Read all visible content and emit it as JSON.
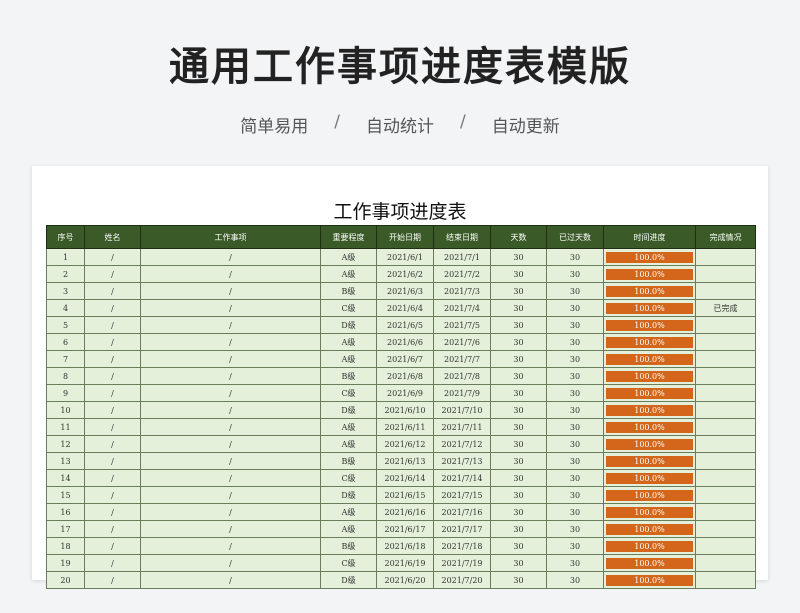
{
  "header": {
    "title": "通用工作事项进度表模版",
    "tags": [
      "简单易用",
      "自动统计",
      "自动更新"
    ],
    "separator": "/"
  },
  "sheet": {
    "title": "工作事项进度表",
    "columns": [
      "序号",
      "姓名",
      "工作事项",
      "重要程度",
      "开始日期",
      "结束日期",
      "天数",
      "已过天数",
      "时间进度",
      "完成情况"
    ],
    "progress_color": "#d3661a",
    "header_color": "#3a5a27",
    "row_color": "#e4f0d9",
    "rows": [
      {
        "no": "1",
        "name": "/",
        "task": "/",
        "level": "A级",
        "start": "2021/6/1",
        "end": "2021/7/1",
        "days": "30",
        "passed": "30",
        "progress": "100.0%",
        "progress_value": 1.0,
        "status": ""
      },
      {
        "no": "2",
        "name": "/",
        "task": "/",
        "level": "A级",
        "start": "2021/6/2",
        "end": "2021/7/2",
        "days": "30",
        "passed": "30",
        "progress": "100.0%",
        "progress_value": 1.0,
        "status": ""
      },
      {
        "no": "3",
        "name": "/",
        "task": "/",
        "level": "B级",
        "start": "2021/6/3",
        "end": "2021/7/3",
        "days": "30",
        "passed": "30",
        "progress": "100.0%",
        "progress_value": 1.0,
        "status": ""
      },
      {
        "no": "4",
        "name": "/",
        "task": "/",
        "level": "C级",
        "start": "2021/6/4",
        "end": "2021/7/4",
        "days": "30",
        "passed": "30",
        "progress": "100.0%",
        "progress_value": 1.0,
        "status": "已完成"
      },
      {
        "no": "5",
        "name": "/",
        "task": "/",
        "level": "D级",
        "start": "2021/6/5",
        "end": "2021/7/5",
        "days": "30",
        "passed": "30",
        "progress": "100.0%",
        "progress_value": 1.0,
        "status": ""
      },
      {
        "no": "6",
        "name": "/",
        "task": "/",
        "level": "A级",
        "start": "2021/6/6",
        "end": "2021/7/6",
        "days": "30",
        "passed": "30",
        "progress": "100.0%",
        "progress_value": 1.0,
        "status": ""
      },
      {
        "no": "7",
        "name": "/",
        "task": "/",
        "level": "A级",
        "start": "2021/6/7",
        "end": "2021/7/7",
        "days": "30",
        "passed": "30",
        "progress": "100.0%",
        "progress_value": 1.0,
        "status": ""
      },
      {
        "no": "8",
        "name": "/",
        "task": "/",
        "level": "B级",
        "start": "2021/6/8",
        "end": "2021/7/8",
        "days": "30",
        "passed": "30",
        "progress": "100.0%",
        "progress_value": 1.0,
        "status": ""
      },
      {
        "no": "9",
        "name": "/",
        "task": "/",
        "level": "C级",
        "start": "2021/6/9",
        "end": "2021/7/9",
        "days": "30",
        "passed": "30",
        "progress": "100.0%",
        "progress_value": 1.0,
        "status": ""
      },
      {
        "no": "10",
        "name": "/",
        "task": "/",
        "level": "D级",
        "start": "2021/6/10",
        "end": "2021/7/10",
        "days": "30",
        "passed": "30",
        "progress": "100.0%",
        "progress_value": 1.0,
        "status": ""
      },
      {
        "no": "11",
        "name": "/",
        "task": "/",
        "level": "A级",
        "start": "2021/6/11",
        "end": "2021/7/11",
        "days": "30",
        "passed": "30",
        "progress": "100.0%",
        "progress_value": 1.0,
        "status": ""
      },
      {
        "no": "12",
        "name": "/",
        "task": "/",
        "level": "A级",
        "start": "2021/6/12",
        "end": "2021/7/12",
        "days": "30",
        "passed": "30",
        "progress": "100.0%",
        "progress_value": 1.0,
        "status": ""
      },
      {
        "no": "13",
        "name": "/",
        "task": "/",
        "level": "B级",
        "start": "2021/6/13",
        "end": "2021/7/13",
        "days": "30",
        "passed": "30",
        "progress": "100.0%",
        "progress_value": 1.0,
        "status": ""
      },
      {
        "no": "14",
        "name": "/",
        "task": "/",
        "level": "C级",
        "start": "2021/6/14",
        "end": "2021/7/14",
        "days": "30",
        "passed": "30",
        "progress": "100.0%",
        "progress_value": 1.0,
        "status": ""
      },
      {
        "no": "15",
        "name": "/",
        "task": "/",
        "level": "D级",
        "start": "2021/6/15",
        "end": "2021/7/15",
        "days": "30",
        "passed": "30",
        "progress": "100.0%",
        "progress_value": 1.0,
        "status": ""
      },
      {
        "no": "16",
        "name": "/",
        "task": "/",
        "level": "A级",
        "start": "2021/6/16",
        "end": "2021/7/16",
        "days": "30",
        "passed": "30",
        "progress": "100.0%",
        "progress_value": 1.0,
        "status": ""
      },
      {
        "no": "17",
        "name": "/",
        "task": "/",
        "level": "A级",
        "start": "2021/6/17",
        "end": "2021/7/17",
        "days": "30",
        "passed": "30",
        "progress": "100.0%",
        "progress_value": 1.0,
        "status": ""
      },
      {
        "no": "18",
        "name": "/",
        "task": "/",
        "level": "B级",
        "start": "2021/6/18",
        "end": "2021/7/18",
        "days": "30",
        "passed": "30",
        "progress": "100.0%",
        "progress_value": 1.0,
        "status": ""
      },
      {
        "no": "19",
        "name": "/",
        "task": "/",
        "level": "C级",
        "start": "2021/6/19",
        "end": "2021/7/19",
        "days": "30",
        "passed": "30",
        "progress": "100.0%",
        "progress_value": 1.0,
        "status": ""
      },
      {
        "no": "20",
        "name": "/",
        "task": "/",
        "level": "D级",
        "start": "2021/6/20",
        "end": "2021/7/20",
        "days": "30",
        "passed": "30",
        "progress": "100.0%",
        "progress_value": 1.0,
        "status": ""
      }
    ]
  }
}
